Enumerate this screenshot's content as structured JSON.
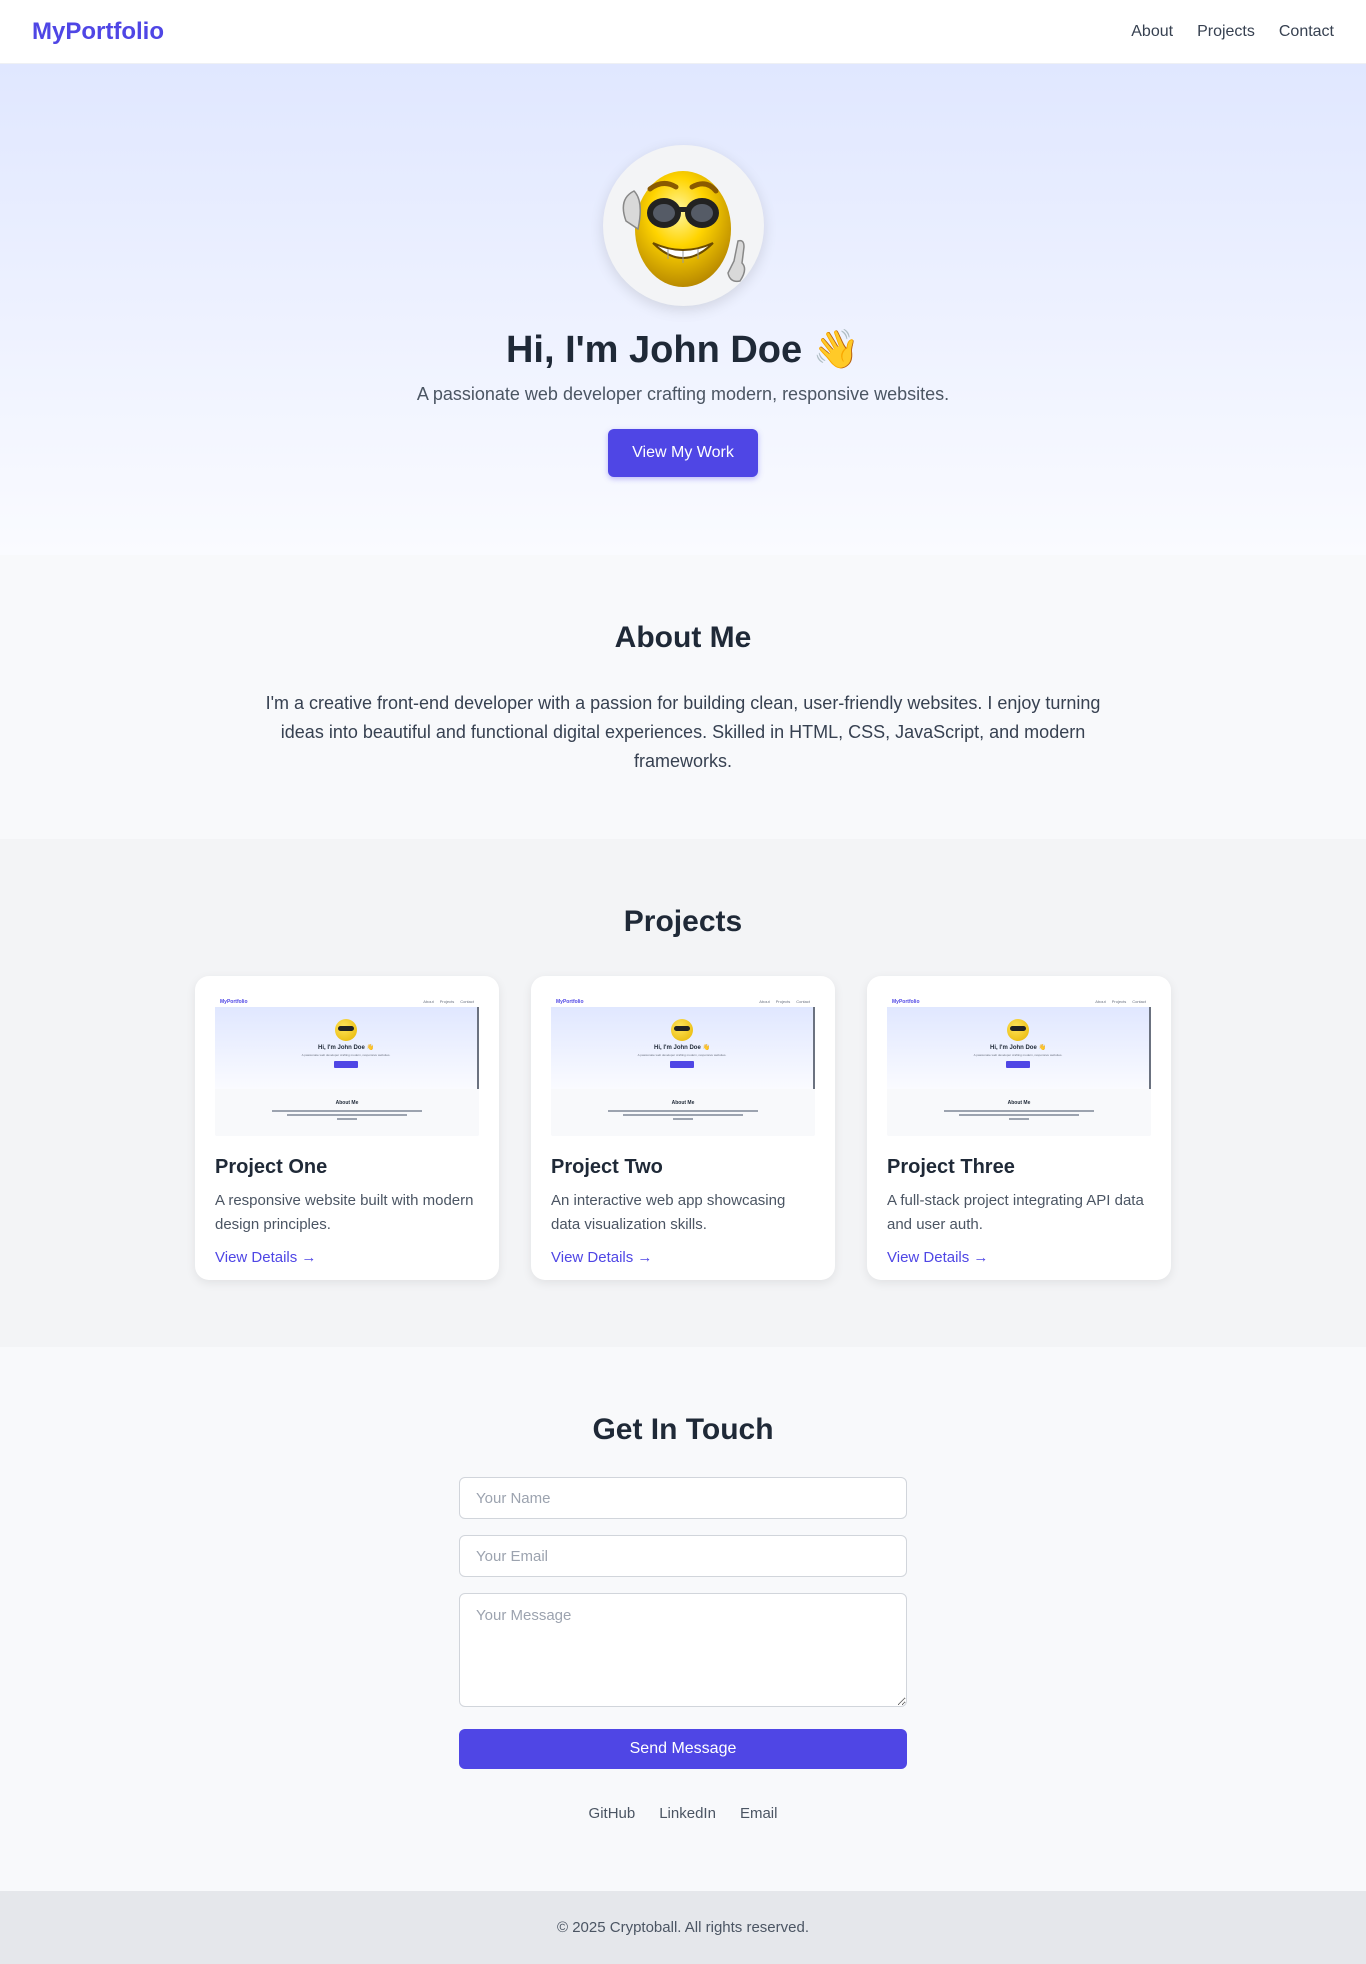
{
  "nav": {
    "brand": "MyPortfolio",
    "links": [
      "About",
      "Projects",
      "Contact"
    ]
  },
  "hero": {
    "avatar_icon": "sunglasses-smiley-icon",
    "title": "Hi, I'm John Doe 👋",
    "subtitle": "A passionate web developer crafting modern, responsive websites.",
    "cta_label": "View My Work"
  },
  "about": {
    "heading": "About Me",
    "text": "I'm a creative front-end developer with a passion for building clean, user-friendly websites. I enjoy turning ideas into beautiful and functional digital experiences. Skilled in HTML, CSS, JavaScript, and modern frameworks."
  },
  "projects": {
    "heading": "Projects",
    "items": [
      {
        "title": "Project One",
        "description": "A responsive website built with modern design principles.",
        "link": "View Details →"
      },
      {
        "title": "Project Two",
        "description": "An interactive web app showcasing data visualization skills.",
        "link": "View Details →"
      },
      {
        "title": "Project Three",
        "description": "A full-stack project integrating API data and user auth.",
        "link": "View Details →"
      }
    ]
  },
  "contact": {
    "heading": "Get In Touch",
    "name_placeholder": "Your Name",
    "email_placeholder": "Your Email",
    "message_placeholder": "Your Message",
    "send_label": "Send Message",
    "socials": [
      "GitHub",
      "LinkedIn",
      "Email"
    ]
  },
  "footer": {
    "text": "© 2025 Cryptoball. All rights reserved."
  },
  "colors": {
    "accent": "#4f46e5",
    "text": "#1f2937",
    "footer_bg": "#e5e7eb"
  }
}
